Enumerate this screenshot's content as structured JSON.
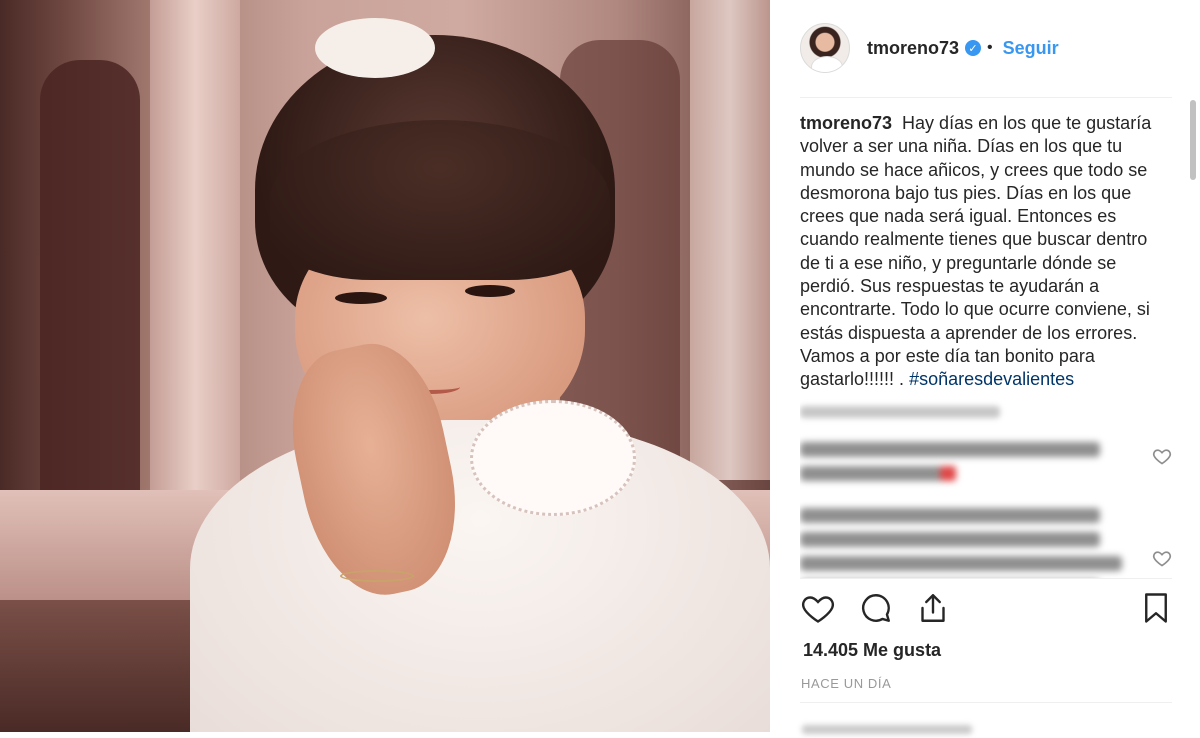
{
  "post": {
    "username": "tmoreno73",
    "verified_symbol": "✓",
    "separator": "•",
    "follow_label": "Seguir",
    "photo_alt": "Fotografía de una niña con las manos juntas junto a la mejilla",
    "caption_user": "tmoreno73",
    "caption_text": "Hay días en los que te gustaría volver a ser una niña. Días en los que tu mundo se hace añicos, y crees que todo se desmorona bajo tus pies. Días en los que crees que nada será igual. Entonces es cuando realmente tienes que buscar dentro de ti a ese niño, y preguntarle dónde se perdió. Sus respuestas te ayudarán a encontrarte. Todo lo que ocurre conviene, si estás dispuesta a aprender de los errores. Vamos a por este día tan bonito para gastarlo!!!!!! .",
    "caption_hashtag": "#soñaresdevalientes",
    "likes_text": "14.405 Me gusta",
    "time_text": "HACE UN DÍA"
  },
  "icons": {
    "like": "heart-icon",
    "comment": "comment-icon",
    "share": "share-icon",
    "save": "bookmark-icon",
    "verified": "verified-badge-icon",
    "comment_like": "heart-icon"
  },
  "colors": {
    "link_blue": "#3897f0",
    "hashtag_blue": "#003569",
    "meta_gray": "#999999",
    "text": "#262626"
  }
}
